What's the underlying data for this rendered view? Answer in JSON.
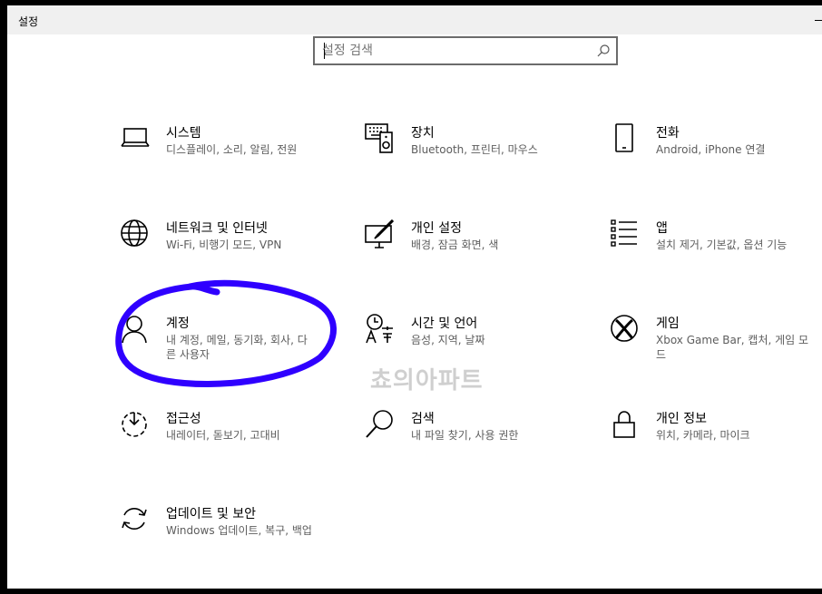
{
  "window": {
    "title": "설정"
  },
  "search": {
    "placeholder": "설정 검색"
  },
  "tiles": [
    {
      "title": "시스템",
      "subtitle": "디스플레이, 소리, 알림, 전원",
      "icon": "laptop-icon"
    },
    {
      "title": "장치",
      "subtitle": "Bluetooth, 프린터, 마우스",
      "icon": "devices-icon"
    },
    {
      "title": "전화",
      "subtitle": "Android, iPhone 연결",
      "icon": "phone-icon"
    },
    {
      "title": "네트워크 및 인터넷",
      "subtitle": "Wi-Fi, 비행기 모드, VPN",
      "icon": "globe-icon"
    },
    {
      "title": "개인 설정",
      "subtitle": "배경, 잠금 화면, 색",
      "icon": "personalization-icon"
    },
    {
      "title": "앱",
      "subtitle": "설치 제거, 기본값, 옵션 기능",
      "icon": "apps-icon"
    },
    {
      "title": "계정",
      "subtitle": "내 계정, 메일, 동기화, 회사, 다른 사용자",
      "icon": "person-icon"
    },
    {
      "title": "시간 및 언어",
      "subtitle": "음성, 지역, 날짜",
      "icon": "time-language-icon"
    },
    {
      "title": "게임",
      "subtitle": "Xbox Game Bar, 캡처, 게임 모드",
      "icon": "xbox-icon"
    },
    {
      "title": "접근성",
      "subtitle": "내레이터, 돋보기, 고대비",
      "icon": "ease-of-access-icon"
    },
    {
      "title": "검색",
      "subtitle": "내 파일 찾기, 사용 권한",
      "icon": "search-icon"
    },
    {
      "title": "개인 정보",
      "subtitle": "위치, 카메라, 마이크",
      "icon": "lock-icon"
    },
    {
      "title": "업데이트 및 보안",
      "subtitle": "Windows 업데이트, 복구, 백업",
      "icon": "update-icon"
    }
  ],
  "watermark": "쵸의아파트",
  "annotation": {
    "color": "#2f00ff"
  }
}
